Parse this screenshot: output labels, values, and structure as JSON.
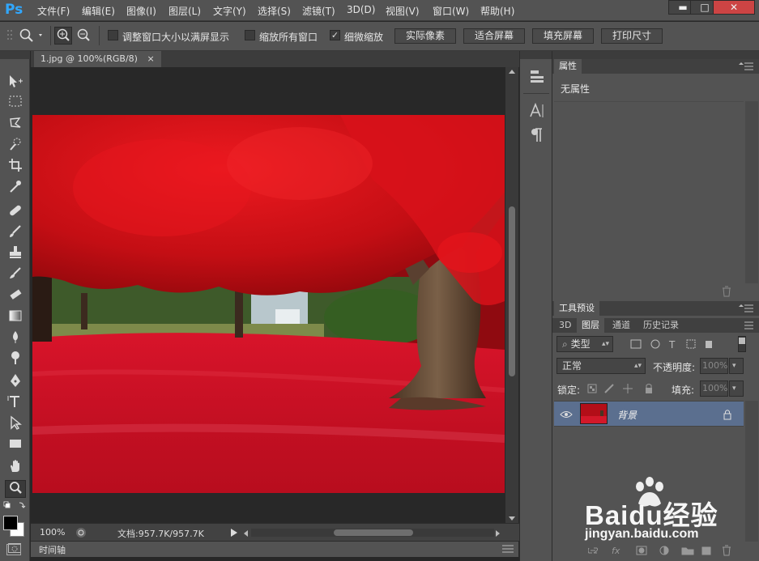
{
  "app": {
    "logo": "Ps"
  },
  "menu": [
    "文件(F)",
    "编辑(E)",
    "图像(I)",
    "图层(L)",
    "文字(Y)",
    "选择(S)",
    "滤镜(T)",
    "3D(D)",
    "视图(V)",
    "窗口(W)",
    "帮助(H)"
  ],
  "window_controls": {
    "minimize": "▬",
    "maximize": "□",
    "close": "✕"
  },
  "options": {
    "resize_windows": {
      "label": "调整窗口大小以满屏显示",
      "checked": false
    },
    "zoom_all_windows": {
      "label": "缩放所有窗口",
      "checked": false
    },
    "scrubby_zoom": {
      "label": "细微缩放",
      "checked": true
    },
    "check_mark": "✓",
    "buttons": [
      "实际像素",
      "适合屏幕",
      "填充屏幕",
      "打印尺寸"
    ]
  },
  "document": {
    "tab_title": "1.jpg @ 100%(RGB/8)",
    "tab_close": "×",
    "zoom": "100%",
    "doc_info": "文档:957.7K/957.7K"
  },
  "timeline": {
    "label": "时间轴"
  },
  "properties": {
    "tab": "属性",
    "content": "无属性"
  },
  "tool_presets": {
    "tab": "工具预设"
  },
  "layers_panel": {
    "tabs": [
      "3D",
      "图层",
      "通道",
      "历史记录"
    ],
    "filter_kind": "类型",
    "blend_mode": "正常",
    "opacity_label": "不透明度:",
    "opacity_value": "100%",
    "lock_label": "锁定:",
    "fill_label": "填充:",
    "fill_value": "100%",
    "layers": [
      {
        "name": "背景",
        "visible": true,
        "locked": true
      }
    ]
  },
  "watermark": {
    "brand": "Baidu经验",
    "url": "jingyan.baidu.com"
  },
  "colors": {
    "chrome": "#535353",
    "workspace": "#282828",
    "selected_layer": "#5b6f8f",
    "ps_blue": "#31a8ff"
  }
}
